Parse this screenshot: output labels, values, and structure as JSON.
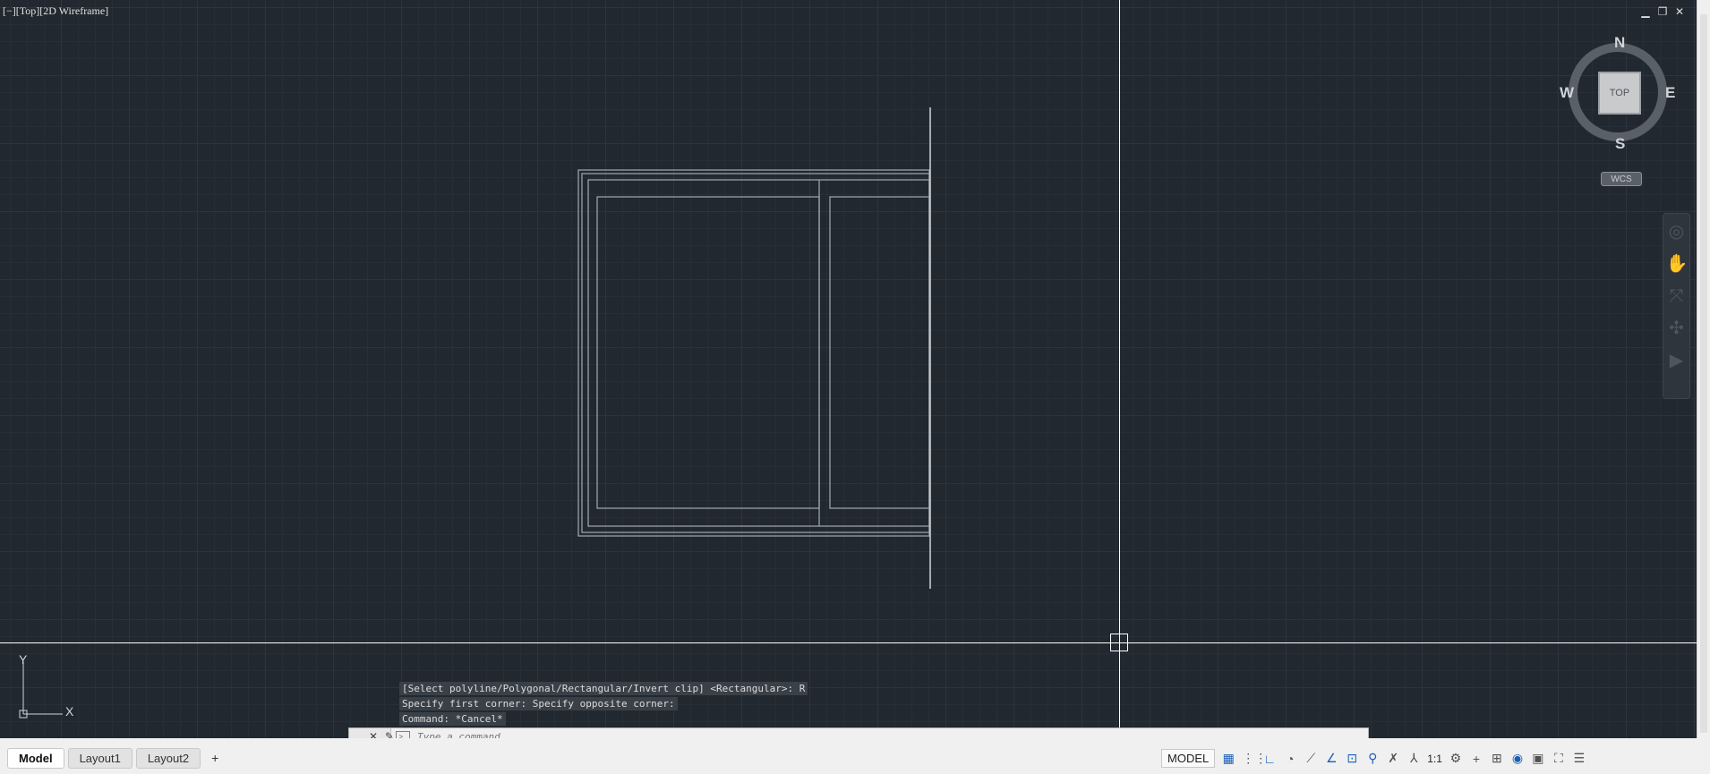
{
  "viewport": {
    "view_label": "[−][Top][2D Wireframe]",
    "window_controls": {
      "minimize": "▁",
      "restore": "❐",
      "close": "✕"
    }
  },
  "viewcube": {
    "top_face": "TOP",
    "north": "N",
    "south": "S",
    "east": "E",
    "west": "W",
    "coordinate_system": "WCS"
  },
  "ucs_icon": {
    "y_label": "Y",
    "x_label": "X"
  },
  "command_line": {
    "history": [
      "[Select polyline/Polygonal/Rectangular/Invert clip] <Rectangular>: R",
      "Specify first corner: Specify opposite corner:",
      "Command: *Cancel*"
    ],
    "placeholder": "Type a command",
    "close_icon": "close-icon",
    "customize_icon": "wrench-icon"
  },
  "layout_tabs": {
    "tabs": [
      "Model",
      "Layout1",
      "Layout2"
    ],
    "active": "Model",
    "add_label": "+"
  },
  "status_bar": {
    "model_label": "MODEL",
    "annotation_scale": "1:1",
    "icons": [
      "grid-icon",
      "snap-icon",
      "ortho-icon",
      "polar-icon",
      "isodraft-icon",
      "osnap-track-icon",
      "osnap-icon",
      "annotation-visibility-icon",
      "auto-scale-icon",
      "annotation-scale-icon",
      "workspace-gear-icon",
      "plus-icon",
      "units-icon",
      "isolate-icon",
      "hardware-accel-icon",
      "clean-screen-icon",
      "customize-icon"
    ]
  },
  "colors": {
    "canvas_bg": "#212830",
    "grid_major": "#2c3440",
    "drawing_lines": "#9aa0a8",
    "accent_blue": "#1a5fb4"
  }
}
